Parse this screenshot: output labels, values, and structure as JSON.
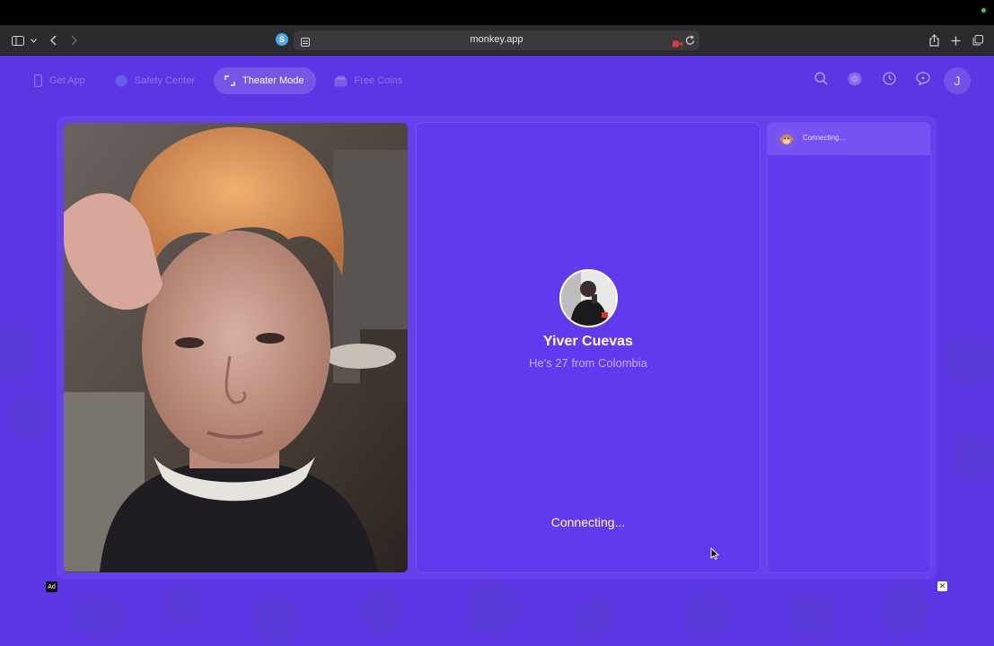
{
  "browser": {
    "url": "monkey.app",
    "favicon_letter": "S"
  },
  "nav": {
    "items": [
      {
        "label": "Get App",
        "icon": "phone-icon",
        "active": false
      },
      {
        "label": "Safety Center",
        "icon": "shield-icon",
        "active": false
      },
      {
        "label": "Theater Mode",
        "icon": "expand-icon",
        "active": true
      },
      {
        "label": "Free Coins",
        "icon": "coins-icon",
        "active": false
      }
    ],
    "right_icons": [
      "search-icon",
      "gem-icon",
      "history-icon",
      "chat-icon"
    ],
    "avatar_letter": "J"
  },
  "match": {
    "name": "Yiver Cuevas",
    "info": "He's 27 from Colombia",
    "status": "Connecting..."
  },
  "sidebar": {
    "item_label": "Connecting...",
    "item_icon": "monkey-icon"
  },
  "ad": {
    "label": "Ad",
    "close": "✕"
  },
  "colors": {
    "accent": "#5b36e2",
    "panel": "#6139ef"
  }
}
